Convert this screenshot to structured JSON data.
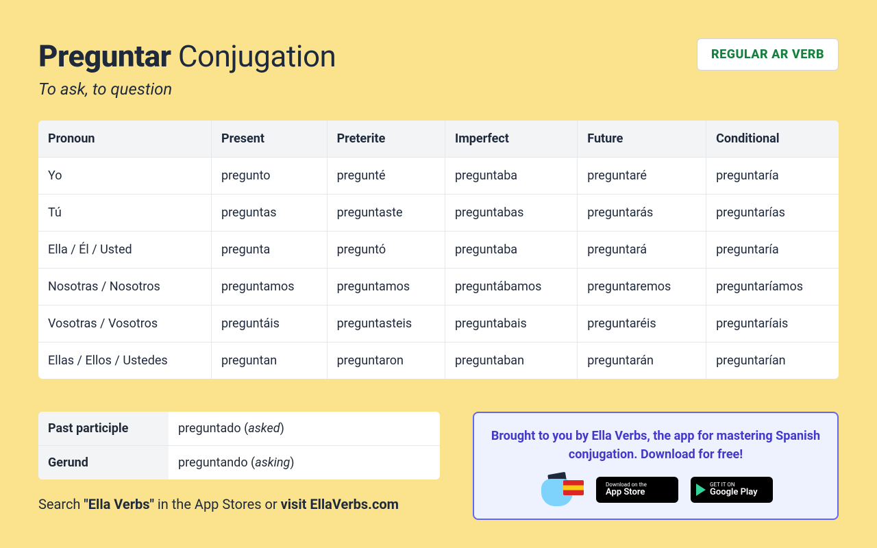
{
  "header": {
    "verb": "Preguntar",
    "title_suffix": "Conjugation",
    "subtitle": "To ask, to question",
    "badge": "REGULAR AR VERB"
  },
  "columns": [
    "Pronoun",
    "Present",
    "Preterite",
    "Imperfect",
    "Future",
    "Conditional"
  ],
  "rows": [
    {
      "pronoun": "Yo",
      "cells": [
        "pregunto",
        "pregunté",
        "preguntaba",
        "preguntaré",
        "preguntaría"
      ]
    },
    {
      "pronoun": "Tú",
      "cells": [
        "preguntas",
        "preguntaste",
        "preguntabas",
        "preguntarás",
        "preguntarías"
      ]
    },
    {
      "pronoun": "Ella / Él / Usted",
      "cells": [
        "pregunta",
        "preguntó",
        "preguntaba",
        "preguntará",
        "preguntaría"
      ]
    },
    {
      "pronoun": "Nosotras / Nosotros",
      "cells": [
        "preguntamos",
        "preguntamos",
        "preguntábamos",
        "preguntaremos",
        "preguntaríamos"
      ]
    },
    {
      "pronoun": "Vosotras / Vosotros",
      "cells": [
        "preguntáis",
        "preguntasteis",
        "preguntabais",
        "preguntaréis",
        "preguntaríais"
      ]
    },
    {
      "pronoun": "Ellas / Ellos / Ustedes",
      "cells": [
        "preguntan",
        "preguntaron",
        "preguntaban",
        "preguntarán",
        "preguntarían"
      ]
    }
  ],
  "extra": {
    "past_participle_label": "Past participle",
    "past_participle_value": "preguntado",
    "past_participle_gloss": "asked",
    "gerund_label": "Gerund",
    "gerund_value": "preguntando",
    "gerund_gloss": "asking"
  },
  "search_line": {
    "prefix": "Search ",
    "term": "\"Ella Verbs\"",
    "mid": " in the App Stores or ",
    "link": "visit EllaVerbs.com"
  },
  "promo": {
    "text": "Brought to you by Ella Verbs, the app for mastering Spanish conjugation. Download for free!",
    "appstore_small": "Download on the",
    "appstore_big": "App Store",
    "gplay_small": "GET IT ON",
    "gplay_big": "Google Play"
  }
}
